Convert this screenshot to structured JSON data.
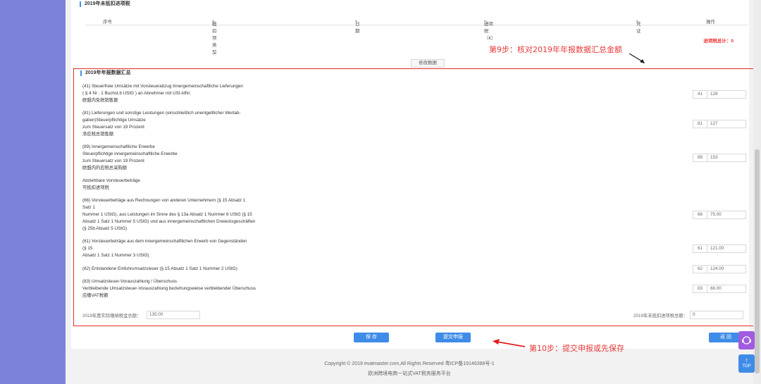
{
  "section_2019_unpaid": {
    "title": "2019年未抵扣进项税",
    "headers": [
      "序号",
      "抵扣项类型",
      "日期",
      "进项税（€）",
      "凭证",
      "操作"
    ],
    "total_label": "进项税总计：0",
    "modify_btn": "修改数据"
  },
  "annotations": {
    "step9": "第9步：核对2019年年报数据汇总金额",
    "step10": "第10步：提交申报或先保存"
  },
  "summary": {
    "title": "2019年年报数据汇总",
    "rows": [
      {
        "lines": [
          "(41)  Steuerfreie Umsätze mit Vorsteuerabzug Innergemeinschaftliche Lieferungen",
          "( § 4 Nr . 1 Buchst.b UStG ) an Abnehmer mit USt-IdNr.",
          "欧盟内免税销售额"
        ],
        "code": "41",
        "value": "128"
      },
      {
        "lines": [
          "(81)  Lieferungen und sonstige Leistungen (einschließlich unentgeltlicher  Wertab-",
          "gaben)Steuerpflichtige Umsätze",
          "zum Steuersatz von 19 Prozent",
          "净应税总销售额"
        ],
        "code": "81",
        "value": "127"
      },
      {
        "lines": [
          "(89)  Innergemeinschaftliche Erwerbe",
          "Steuerpflichtige innergemeinschaftliche Erwerbe",
          "zum Steuersatz von 19 Prozent",
          "欧盟内的应税总采购额"
        ],
        "code": "89",
        "value": "153"
      },
      {
        "lines": [
          "Abziehbare Vorsteuerbeträge",
          "可抵扣进项税"
        ],
        "code": "",
        "value": ""
      },
      {
        "lines": [
          "(66)  Vorsteuerbeträge aus Rechnungen von anderen Unternehmern (§ 15 Absatz 1",
          "Satz 1",
          "Nummer 1 UStG), aus Leistungen im Sinne des § 13a Absatz 1 Nummer 6 UStG (§ 15",
          "Absatz 1 Satz 1 Nummer 5 UStG) und aus innergemeinschaftlichen Dreiecksgeschäften",
          "(§ 25b Absatz 5 UStG)"
        ],
        "code": "66",
        "value": "75.00"
      },
      {
        "lines": [
          "(61)  Vorsteuerbeträge aus dem innergemeinschaftlichen Erwerb von Gegenständen",
          "(§ 15",
          "Absatz 1 Satz 1 Nummer 3 UStG)"
        ],
        "code": "61",
        "value": "121.00"
      },
      {
        "lines": [
          "(62)  Entstandene Einfuhrumsatzsteuer (§ 15 Absatz 1 Satz 1 Nummer 2 UStG)"
        ],
        "code": "62",
        "value": "124.00"
      },
      {
        "lines": [
          "(83)  Umsatzsteuer-Vorauszahlung / Überschuss",
          "Verbleibende Umsatzsteuer-Vorauszahlung beziehungsweise verbleibender Überschuss",
          "应缴VAT税额"
        ],
        "code": "83",
        "value": "66.00"
      }
    ],
    "actual_paid_label": "2019年度实际缴纳税金总额：",
    "actual_paid_value": "135.00",
    "unpaid_input_label": "2019年未抵扣进项税总额：",
    "unpaid_input_value": "0"
  },
  "buttons": {
    "save": "保 存",
    "submit": "提交申报",
    "back": "返 回"
  },
  "footer": {
    "line1": "Copyright © 2019 evatmaster.com,All Rights Reserved 粤ICP备19146388号-1",
    "line2": "欧洲跨境电商一站式VAT税务服务平台"
  },
  "float": {
    "top": "TOP"
  },
  "colors": {
    "sidebar": "#7c82d9",
    "primary": "#3f8ce8",
    "annotation": "#e83a3a",
    "float_purple": "#a05ce0"
  }
}
